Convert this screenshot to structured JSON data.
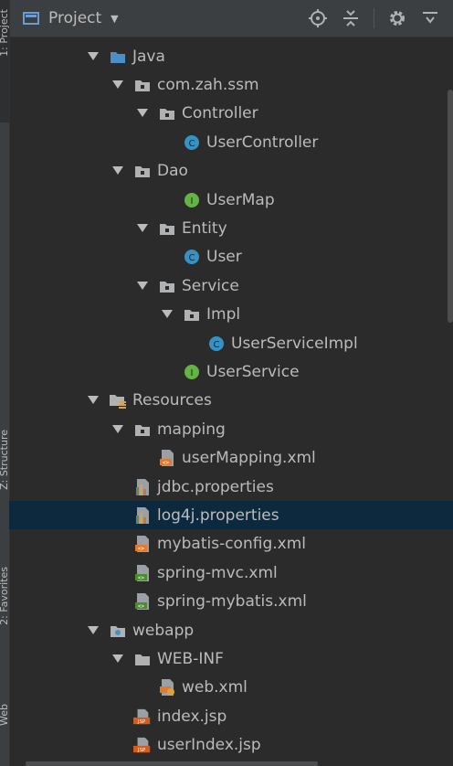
{
  "header": {
    "title": "Project",
    "caret": "▼",
    "tools": [
      "locate-icon",
      "collapse-all-icon",
      "gear-icon",
      "hide-icon"
    ]
  },
  "stripe": {
    "labels": [
      "1: Project",
      "Z: Structure",
      "2: Favorites",
      "Web"
    ]
  },
  "tree": [
    {
      "label": "Java",
      "icon": "source-folder",
      "expanded": true
    },
    {
      "label": "com.zah.ssm",
      "icon": "package",
      "expanded": true
    },
    {
      "label": "Controller",
      "icon": "package",
      "expanded": true
    },
    {
      "label": "UserController",
      "icon": "class",
      "expanded": null
    },
    {
      "label": "Dao",
      "icon": "package",
      "expanded": true
    },
    {
      "label": "UserMap",
      "icon": "interface",
      "expanded": null
    },
    {
      "label": "Entity",
      "icon": "package",
      "expanded": true
    },
    {
      "label": "User",
      "icon": "class",
      "expanded": null
    },
    {
      "label": "Service",
      "icon": "package",
      "expanded": true
    },
    {
      "label": "Impl",
      "icon": "package",
      "expanded": true
    },
    {
      "label": "UserServiceImpl",
      "icon": "class",
      "expanded": null
    },
    {
      "label": "UserService",
      "icon": "interface",
      "expanded": null
    },
    {
      "label": "Resources",
      "icon": "resources-folder",
      "expanded": true
    },
    {
      "label": "mapping",
      "icon": "package",
      "expanded": true
    },
    {
      "label": "userMapping.xml",
      "icon": "xml",
      "expanded": null
    },
    {
      "label": "jdbc.properties",
      "icon": "properties",
      "expanded": null
    },
    {
      "label": "log4j.properties",
      "icon": "properties",
      "expanded": null,
      "selected": true
    },
    {
      "label": "mybatis-config.xml",
      "icon": "xml",
      "expanded": null
    },
    {
      "label": "spring-mvc.xml",
      "icon": "spring-xml",
      "expanded": null
    },
    {
      "label": "spring-mybatis.xml",
      "icon": "spring-xml",
      "expanded": null
    },
    {
      "label": "webapp",
      "icon": "web-folder",
      "expanded": true
    },
    {
      "label": "WEB-INF",
      "icon": "folder",
      "expanded": true
    },
    {
      "label": "web.xml",
      "icon": "web-xml",
      "expanded": null
    },
    {
      "label": "index.jsp",
      "icon": "jsp",
      "expanded": null
    },
    {
      "label": "userIndex.jsp",
      "icon": "jsp",
      "expanded": null
    }
  ],
  "colors": {
    "background": "#2b2b2b",
    "selection": "#0d293e",
    "class_icon": "#3592c4",
    "interface_icon": "#62b543",
    "folder_icon": "#afb1b3",
    "source_folder": "#4a8fc7",
    "xml_icon": "#e17a2c",
    "jsp_icon": "#d35d1f"
  }
}
